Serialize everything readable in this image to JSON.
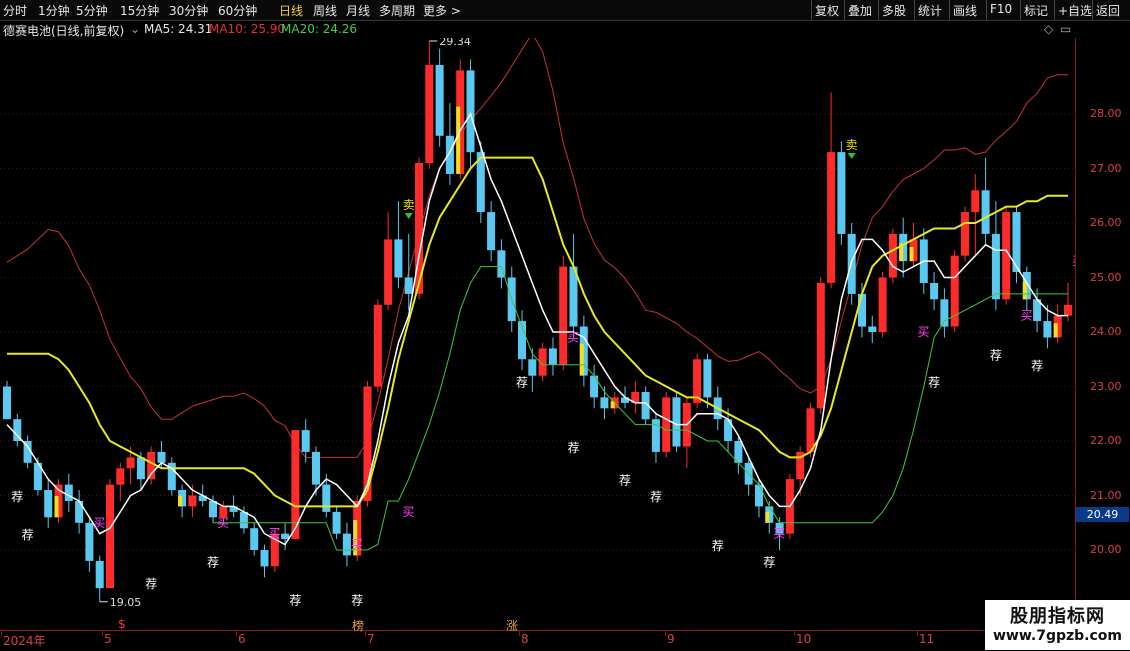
{
  "toolbar": {
    "left_items": [
      "分时",
      "1分钟",
      "5分钟",
      "15分钟",
      "30分钟",
      "60分钟",
      "日线",
      "周线",
      "月线",
      "多周期",
      "更多 >"
    ],
    "active": "日线",
    "right_items": [
      "复权",
      "叠加",
      "多股",
      "统计",
      "画线",
      "F10",
      "标记",
      "+自选",
      "返回"
    ]
  },
  "info": {
    "title": "德赛电池(日线,前复权)",
    "ma5_label": "MA5: 24.31",
    "ma10_label": "MA10: 25.90",
    "ma20_label": "MA20: 24.26"
  },
  "colors": {
    "up": "#ff2b2b",
    "down": "#5ac8f0",
    "ma5": "#ffffff",
    "ma10": "#e8e820",
    "ma20": "#3cc83c",
    "band": "#c83232",
    "signal_buy": "#ff40ff",
    "tui": "#ffffff"
  },
  "axis": {
    "price_labels": [
      "28.00",
      "27.00",
      "26.00",
      "25.00",
      "24.00",
      "23.00",
      "22.00",
      "21.00",
      "20.00"
    ],
    "last_price": "20.49",
    "date_labels": [
      "2024年",
      "5",
      "6",
      "7",
      "8",
      "9",
      "10",
      "11"
    ],
    "date_markers": [
      "$",
      "榜",
      "涨"
    ]
  },
  "annotations": {
    "high": "29.34",
    "low": "19.05"
  },
  "watermark": {
    "title": "股朋指标网",
    "url": "www.7gpzb.com"
  },
  "chart_data": {
    "type": "candlestick",
    "title": "德赛电池(日线,前复权)",
    "ylim": [
      19.0,
      30.0
    ],
    "x_months": [
      "2024-04",
      "2024-05",
      "2024-06",
      "2024-07",
      "2024-08",
      "2024-09",
      "2024-10",
      "2024-11"
    ],
    "candles": [
      {
        "o": 23.0,
        "h": 23.1,
        "l": 22.4,
        "c": 22.4
      },
      {
        "o": 22.4,
        "h": 22.5,
        "l": 21.9,
        "c": 22.0
      },
      {
        "o": 22.0,
        "h": 22.1,
        "l": 21.5,
        "c": 21.6
      },
      {
        "o": 21.6,
        "h": 21.7,
        "l": 21.0,
        "c": 21.1
      },
      {
        "o": 21.1,
        "h": 21.3,
        "l": 20.4,
        "c": 20.6
      },
      {
        "o": 20.6,
        "h": 21.3,
        "l": 20.5,
        "c": 21.2
      },
      {
        "o": 21.2,
        "h": 21.4,
        "l": 20.7,
        "c": 20.9
      },
      {
        "o": 20.9,
        "h": 21.1,
        "l": 20.3,
        "c": 20.5
      },
      {
        "o": 20.5,
        "h": 20.6,
        "l": 19.6,
        "c": 19.8
      },
      {
        "o": 19.8,
        "h": 19.9,
        "l": 19.05,
        "c": 19.3
      },
      {
        "o": 19.3,
        "h": 21.3,
        "l": 19.3,
        "c": 21.2
      },
      {
        "o": 21.2,
        "h": 21.6,
        "l": 20.9,
        "c": 21.5
      },
      {
        "o": 21.5,
        "h": 21.9,
        "l": 21.2,
        "c": 21.7
      },
      {
        "o": 21.7,
        "h": 21.8,
        "l": 21.1,
        "c": 21.3
      },
      {
        "o": 21.3,
        "h": 21.9,
        "l": 21.2,
        "c": 21.8
      },
      {
        "o": 21.8,
        "h": 22.0,
        "l": 21.5,
        "c": 21.6
      },
      {
        "o": 21.6,
        "h": 21.7,
        "l": 21.0,
        "c": 21.1
      },
      {
        "o": 21.1,
        "h": 21.2,
        "l": 20.6,
        "c": 20.8
      },
      {
        "o": 20.8,
        "h": 21.2,
        "l": 20.6,
        "c": 21.0
      },
      {
        "o": 21.0,
        "h": 21.2,
        "l": 20.8,
        "c": 20.9
      },
      {
        "o": 20.9,
        "h": 21.0,
        "l": 20.5,
        "c": 20.6
      },
      {
        "o": 20.6,
        "h": 20.9,
        "l": 20.5,
        "c": 20.8
      },
      {
        "o": 20.8,
        "h": 21.0,
        "l": 20.6,
        "c": 20.7
      },
      {
        "o": 20.7,
        "h": 20.8,
        "l": 20.3,
        "c": 20.4
      },
      {
        "o": 20.4,
        "h": 20.5,
        "l": 19.9,
        "c": 20.0
      },
      {
        "o": 20.0,
        "h": 20.1,
        "l": 19.5,
        "c": 19.7
      },
      {
        "o": 19.7,
        "h": 20.4,
        "l": 19.6,
        "c": 20.3
      },
      {
        "o": 20.3,
        "h": 20.5,
        "l": 20.0,
        "c": 20.2
      },
      {
        "o": 20.2,
        "h": 22.2,
        "l": 20.2,
        "c": 22.2
      },
      {
        "o": 22.2,
        "h": 22.4,
        "l": 21.6,
        "c": 21.8
      },
      {
        "o": 21.8,
        "h": 21.9,
        "l": 21.0,
        "c": 21.2
      },
      {
        "o": 21.2,
        "h": 21.4,
        "l": 20.6,
        "c": 20.7
      },
      {
        "o": 20.7,
        "h": 20.8,
        "l": 20.2,
        "c": 20.3
      },
      {
        "o": 20.3,
        "h": 20.5,
        "l": 19.7,
        "c": 19.9
      },
      {
        "o": 19.9,
        "h": 21.0,
        "l": 19.8,
        "c": 20.9
      },
      {
        "o": 20.9,
        "h": 23.1,
        "l": 20.8,
        "c": 23.0
      },
      {
        "o": 23.0,
        "h": 24.6,
        "l": 22.9,
        "c": 24.5
      },
      {
        "o": 24.5,
        "h": 26.2,
        "l": 24.4,
        "c": 25.7
      },
      {
        "o": 25.7,
        "h": 26.4,
        "l": 24.8,
        "c": 25.0
      },
      {
        "o": 25.0,
        "h": 25.8,
        "l": 24.4,
        "c": 24.7
      },
      {
        "o": 24.7,
        "h": 27.2,
        "l": 24.6,
        "c": 27.1
      },
      {
        "o": 27.1,
        "h": 29.34,
        "l": 27.0,
        "c": 28.9
      },
      {
        "o": 28.9,
        "h": 29.2,
        "l": 27.4,
        "c": 27.6
      },
      {
        "o": 27.6,
        "h": 28.2,
        "l": 26.7,
        "c": 26.9
      },
      {
        "o": 26.9,
        "h": 29.0,
        "l": 26.8,
        "c": 28.8
      },
      {
        "o": 28.8,
        "h": 29.0,
        "l": 27.0,
        "c": 27.3
      },
      {
        "o": 27.3,
        "h": 27.5,
        "l": 26.0,
        "c": 26.2
      },
      {
        "o": 26.2,
        "h": 26.4,
        "l": 25.3,
        "c": 25.5
      },
      {
        "o": 25.5,
        "h": 25.7,
        "l": 24.8,
        "c": 25.0
      },
      {
        "o": 25.0,
        "h": 25.2,
        "l": 24.0,
        "c": 24.2
      },
      {
        "o": 24.2,
        "h": 24.4,
        "l": 23.3,
        "c": 23.5
      },
      {
        "o": 23.5,
        "h": 23.7,
        "l": 22.9,
        "c": 23.2
      },
      {
        "o": 23.2,
        "h": 23.8,
        "l": 23.1,
        "c": 23.7
      },
      {
        "o": 23.7,
        "h": 23.9,
        "l": 23.2,
        "c": 23.4
      },
      {
        "o": 23.4,
        "h": 25.4,
        "l": 23.3,
        "c": 25.2
      },
      {
        "o": 25.2,
        "h": 25.8,
        "l": 23.9,
        "c": 24.1
      },
      {
        "o": 24.1,
        "h": 24.3,
        "l": 23.0,
        "c": 23.2
      },
      {
        "o": 23.2,
        "h": 23.4,
        "l": 22.6,
        "c": 22.8
      },
      {
        "o": 22.8,
        "h": 23.0,
        "l": 22.4,
        "c": 22.6
      },
      {
        "o": 22.6,
        "h": 22.9,
        "l": 22.5,
        "c": 22.8
      },
      {
        "o": 22.8,
        "h": 23.0,
        "l": 22.6,
        "c": 22.7
      },
      {
        "o": 22.7,
        "h": 23.1,
        "l": 22.5,
        "c": 22.9
      },
      {
        "o": 22.9,
        "h": 23.0,
        "l": 22.3,
        "c": 22.4
      },
      {
        "o": 22.4,
        "h": 22.5,
        "l": 21.6,
        "c": 21.8
      },
      {
        "o": 21.8,
        "h": 22.9,
        "l": 21.7,
        "c": 22.8
      },
      {
        "o": 22.8,
        "h": 22.9,
        "l": 21.8,
        "c": 21.9
      },
      {
        "o": 21.9,
        "h": 22.8,
        "l": 21.5,
        "c": 22.7
      },
      {
        "o": 22.7,
        "h": 23.6,
        "l": 22.6,
        "c": 23.5
      },
      {
        "o": 23.5,
        "h": 23.6,
        "l": 22.6,
        "c": 22.8
      },
      {
        "o": 22.8,
        "h": 23.0,
        "l": 22.2,
        "c": 22.4
      },
      {
        "o": 22.4,
        "h": 22.6,
        "l": 21.8,
        "c": 22.0
      },
      {
        "o": 22.0,
        "h": 22.1,
        "l": 21.4,
        "c": 21.6
      },
      {
        "o": 21.6,
        "h": 21.7,
        "l": 21.0,
        "c": 21.2
      },
      {
        "o": 21.2,
        "h": 21.3,
        "l": 20.6,
        "c": 20.8
      },
      {
        "o": 20.8,
        "h": 20.9,
        "l": 20.3,
        "c": 20.5
      },
      {
        "o": 20.5,
        "h": 20.6,
        "l": 20.0,
        "c": 20.3
      },
      {
        "o": 20.3,
        "h": 21.4,
        "l": 20.2,
        "c": 21.3
      },
      {
        "o": 21.3,
        "h": 21.9,
        "l": 21.0,
        "c": 21.8
      },
      {
        "o": 21.8,
        "h": 22.7,
        "l": 21.7,
        "c": 22.6
      },
      {
        "o": 22.6,
        "h": 25.0,
        "l": 22.5,
        "c": 24.9
      },
      {
        "o": 24.9,
        "h": 28.4,
        "l": 24.8,
        "c": 27.3
      },
      {
        "o": 27.3,
        "h": 27.5,
        "l": 25.6,
        "c": 25.8
      },
      {
        "o": 25.8,
        "h": 26.0,
        "l": 24.5,
        "c": 24.7
      },
      {
        "o": 24.7,
        "h": 24.9,
        "l": 23.9,
        "c": 24.1
      },
      {
        "o": 24.1,
        "h": 24.3,
        "l": 23.8,
        "c": 24.0
      },
      {
        "o": 24.0,
        "h": 25.1,
        "l": 23.9,
        "c": 25.0
      },
      {
        "o": 25.0,
        "h": 25.9,
        "l": 24.9,
        "c": 25.8
      },
      {
        "o": 25.8,
        "h": 26.1,
        "l": 25.0,
        "c": 25.3
      },
      {
        "o": 25.3,
        "h": 26.0,
        "l": 25.2,
        "c": 25.7
      },
      {
        "o": 25.7,
        "h": 25.9,
        "l": 24.7,
        "c": 24.9
      },
      {
        "o": 24.9,
        "h": 25.1,
        "l": 24.4,
        "c": 24.6
      },
      {
        "o": 24.6,
        "h": 24.8,
        "l": 23.9,
        "c": 24.1
      },
      {
        "o": 24.1,
        "h": 25.5,
        "l": 24.0,
        "c": 25.4
      },
      {
        "o": 25.4,
        "h": 26.3,
        "l": 25.3,
        "c": 26.2
      },
      {
        "o": 26.2,
        "h": 26.9,
        "l": 25.4,
        "c": 26.6
      },
      {
        "o": 26.6,
        "h": 27.2,
        "l": 25.6,
        "c": 25.8
      },
      {
        "o": 25.8,
        "h": 26.4,
        "l": 24.4,
        "c": 24.6
      },
      {
        "o": 24.6,
        "h": 26.3,
        "l": 24.5,
        "c": 26.2
      },
      {
        "o": 26.2,
        "h": 26.3,
        "l": 24.9,
        "c": 25.1
      },
      {
        "o": 25.1,
        "h": 25.2,
        "l": 24.4,
        "c": 24.6
      },
      {
        "o": 24.6,
        "h": 24.8,
        "l": 24.0,
        "c": 24.2
      },
      {
        "o": 24.2,
        "h": 24.5,
        "l": 23.7,
        "c": 23.9
      },
      {
        "o": 23.9,
        "h": 24.5,
        "l": 23.8,
        "c": 24.3
      },
      {
        "o": 24.3,
        "h": 24.9,
        "l": 24.2,
        "c": 24.5
      }
    ],
    "ma5": [
      22.3,
      22.1,
      21.9,
      21.6,
      21.3,
      21.1,
      21.0,
      20.9,
      20.6,
      20.3,
      20.4,
      20.7,
      21.0,
      21.1,
      21.4,
      21.6,
      21.5,
      21.3,
      21.1,
      21.0,
      20.9,
      20.8,
      20.8,
      20.7,
      20.6,
      20.3,
      20.2,
      20.1,
      20.4,
      20.8,
      21.1,
      21.3,
      21.2,
      21.0,
      20.8,
      21.2,
      22.0,
      23.0,
      23.8,
      24.3,
      25.4,
      26.4,
      27.0,
      27.3,
      27.7,
      28.0,
      27.4,
      26.8,
      26.4,
      25.9,
      25.4,
      24.9,
      24.4,
      24.0,
      24.0,
      24.0,
      23.9,
      23.6,
      23.3,
      23.0,
      22.8,
      22.7,
      22.7,
      22.5,
      22.4,
      22.3,
      22.3,
      22.5,
      22.5,
      22.5,
      22.4,
      22.1,
      21.7,
      21.3,
      21.0,
      20.8,
      20.8,
      21.1,
      21.5,
      22.2,
      23.5,
      24.6,
      25.3,
      25.7,
      25.7,
      25.5,
      25.2,
      25.1,
      25.2,
      25.3,
      25.3,
      25.0,
      25.0,
      25.2,
      25.4,
      25.6,
      25.5,
      25.5,
      25.2,
      24.9,
      24.6,
      24.4,
      24.3,
      24.3
    ],
    "ma10": [
      23.6,
      23.6,
      23.6,
      23.6,
      23.6,
      23.5,
      23.3,
      23.0,
      22.7,
      22.3,
      22.0,
      21.9,
      21.8,
      21.7,
      21.6,
      21.5,
      21.5,
      21.5,
      21.5,
      21.5,
      21.5,
      21.5,
      21.5,
      21.5,
      21.4,
      21.2,
      21.0,
      20.9,
      20.8,
      20.8,
      20.8,
      20.8,
      20.8,
      20.8,
      20.8,
      21.1,
      21.8,
      22.6,
      23.5,
      24.2,
      24.9,
      25.6,
      26.1,
      26.4,
      26.7,
      27.0,
      27.2,
      27.2,
      27.2,
      27.2,
      27.2,
      27.2,
      26.8,
      26.2,
      25.6,
      25.2,
      24.7,
      24.3,
      24.0,
      23.8,
      23.6,
      23.4,
      23.2,
      23.1,
      23.0,
      22.9,
      22.8,
      22.8,
      22.7,
      22.6,
      22.5,
      22.4,
      22.3,
      22.2,
      22.0,
      21.8,
      21.7,
      21.7,
      21.8,
      22.1,
      22.6,
      23.3,
      24.0,
      24.7,
      25.2,
      25.4,
      25.5,
      25.6,
      25.7,
      25.8,
      25.9,
      25.9,
      25.9,
      26.0,
      26.0,
      26.1,
      26.2,
      26.3,
      26.3,
      26.4,
      26.4,
      26.5,
      26.5,
      26.5
    ],
    "ma20": [
      null,
      null,
      null,
      null,
      null,
      null,
      null,
      null,
      null,
      null,
      null,
      null,
      null,
      null,
      null,
      null,
      null,
      null,
      null,
      null,
      20.5,
      20.5,
      20.5,
      20.5,
      20.5,
      20.5,
      20.5,
      20.5,
      20.5,
      20.5,
      20.5,
      20.5,
      20.0,
      20.0,
      20.0,
      20.0,
      20.1,
      20.9,
      20.9,
      21.3,
      21.8,
      22.3,
      22.9,
      23.6,
      24.4,
      24.9,
      25.2,
      25.2,
      25.2,
      24.6,
      24.1,
      23.6,
      23.4,
      23.4,
      23.4,
      23.4,
      23.4,
      23.2,
      22.9,
      22.7,
      22.5,
      22.3,
      22.3,
      22.3,
      22.2,
      22.2,
      22.2,
      22.1,
      22.0,
      22.0,
      21.8,
      21.6,
      21.4,
      21.2,
      20.8,
      20.5,
      20.5,
      20.5,
      20.5,
      20.5,
      20.5,
      20.5,
      20.5,
      20.5,
      20.5,
      20.7,
      21.0,
      21.5,
      22.2,
      23.0,
      23.9,
      24.2,
      24.3,
      24.4,
      24.5,
      24.6,
      24.7,
      24.7,
      24.7,
      24.7,
      24.7,
      24.7,
      24.7,
      24.7
    ],
    "signals": {
      "buy": [
        {
          "i": 8,
          "price": 20.5
        },
        {
          "i": 20,
          "price": 20.5
        },
        {
          "i": 25,
          "price": 20.3
        },
        {
          "i": 33,
          "price": 20.1
        },
        {
          "i": 38,
          "price": 20.7
        },
        {
          "i": 54,
          "price": 23.9
        },
        {
          "i": 74,
          "price": 20.3
        },
        {
          "i": 88,
          "price": 24.0
        },
        {
          "i": 98,
          "price": 24.3
        },
        {
          "i": 103,
          "price": 25.3
        }
      ],
      "sell": [
        {
          "i": 39,
          "price": 26.0
        },
        {
          "i": 82,
          "price": 27.1
        }
      ],
      "tui": [
        {
          "i": 1,
          "price": 20.9
        },
        {
          "i": 2,
          "price": 20.2
        },
        {
          "i": 14,
          "price": 19.3
        },
        {
          "i": 20,
          "price": 19.7
        },
        {
          "i": 28,
          "price": 19.0
        },
        {
          "i": 34,
          "price": 19.0
        },
        {
          "i": 50,
          "price": 23.0
        },
        {
          "i": 55,
          "price": 21.8
        },
        {
          "i": 60,
          "price": 21.2
        },
        {
          "i": 63,
          "price": 20.9
        },
        {
          "i": 69,
          "price": 20.0
        },
        {
          "i": 74,
          "price": 19.7
        },
        {
          "i": 90,
          "price": 23.0
        },
        {
          "i": 96,
          "price": 23.5
        },
        {
          "i": 100,
          "price": 23.3
        }
      ]
    }
  }
}
